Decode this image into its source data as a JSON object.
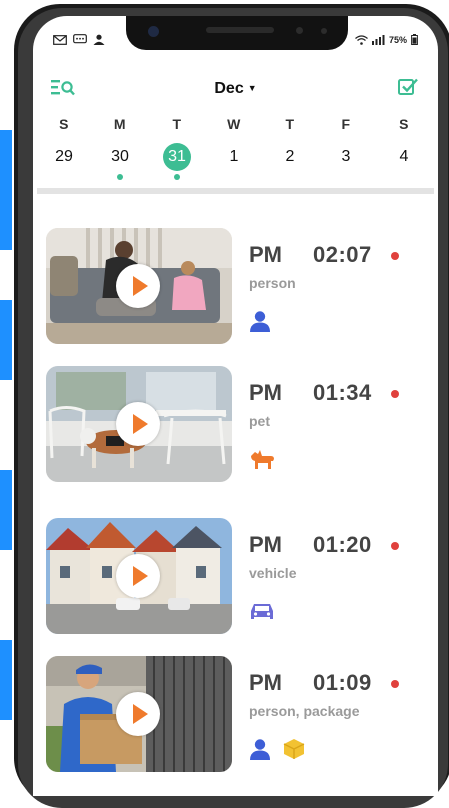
{
  "status_bar": {
    "left_icons": [
      "mail-icon",
      "message-icon",
      "account-icon"
    ],
    "battery_text": "75%",
    "right_icons": [
      "wifi-icon",
      "signal-icon",
      "battery-icon"
    ]
  },
  "header": {
    "month": "Dec",
    "filter_icon": "filter-search-icon",
    "select_icon": "checkbox-icon"
  },
  "week": {
    "days": [
      {
        "name": "S",
        "num": "29",
        "dot": false,
        "selected": false
      },
      {
        "name": "M",
        "num": "30",
        "dot": true,
        "selected": false
      },
      {
        "name": "T",
        "num": "31",
        "dot": true,
        "selected": true
      },
      {
        "name": "W",
        "num": "1",
        "dot": false,
        "selected": false
      },
      {
        "name": "T",
        "num": "2",
        "dot": false,
        "selected": false
      },
      {
        "name": "F",
        "num": "3",
        "dot": false,
        "selected": false
      },
      {
        "name": "S",
        "num": "4",
        "dot": false,
        "selected": false
      }
    ]
  },
  "colors": {
    "accent": "#3dbd93",
    "play": "#ef7a2c",
    "record_dot": "#e0413d",
    "person_icon": "#3d5ed6",
    "pet_icon": "#ef7a2c",
    "vehicle_icon": "#6b6bd6",
    "package_icon": "#f2c232"
  },
  "events": [
    {
      "ampm": "PM",
      "time": "02:07",
      "label": "person",
      "icons": [
        "person-icon"
      ]
    },
    {
      "ampm": "PM",
      "time": "01:34",
      "label": "pet",
      "icons": [
        "pet-icon"
      ]
    },
    {
      "ampm": "PM",
      "time": "01:20",
      "label": "vehicle",
      "icons": [
        "vehicle-icon"
      ]
    },
    {
      "ampm": "PM",
      "time": "01:09",
      "label": "person, package",
      "icons": [
        "person-icon",
        "package-icon"
      ]
    }
  ]
}
